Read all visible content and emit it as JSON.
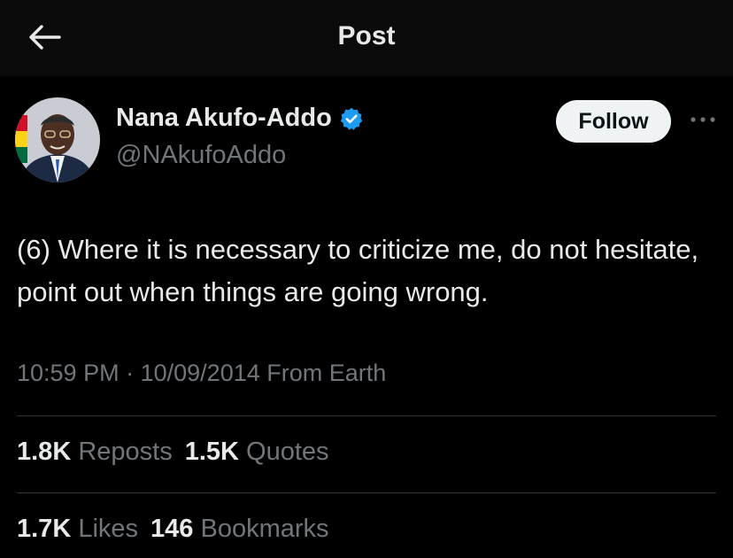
{
  "header": {
    "back_icon": "arrow-left-icon",
    "title": "Post"
  },
  "author": {
    "name": "Nana Akufo-Addo",
    "handle": "@NAkufoAddo",
    "verified_icon": "verified-badge-icon",
    "verified_color": "#1d9bf0"
  },
  "actions": {
    "follow_label": "Follow",
    "more_icon": "more-horizontal-icon"
  },
  "tweet": {
    "text": "(6) Where it is necessary to criticize me, do not hesitate, point out when things are going wrong.",
    "time": "10:59 PM",
    "separator": "·",
    "date": "10/09/2014",
    "location": "From Earth"
  },
  "stats": {
    "reposts_count": "1.8K",
    "reposts_label": "Reposts",
    "quotes_count": "1.5K",
    "quotes_label": "Quotes",
    "likes_count": "1.7K",
    "likes_label": "Likes",
    "bookmarks_count": "146",
    "bookmarks_label": "Bookmarks"
  },
  "colors": {
    "background": "#000000",
    "text_primary": "#e7e9ea",
    "text_secondary": "#71767b",
    "divider": "#2f3336",
    "follow_bg": "#eff3f4"
  }
}
